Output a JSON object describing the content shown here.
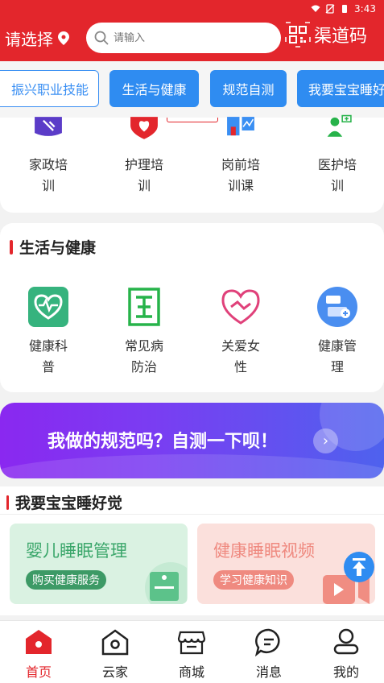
{
  "status": {
    "time": "3:43"
  },
  "header": {
    "location_label": "请选择",
    "search_placeholder": "请输入",
    "qr_label": "渠道码"
  },
  "tabs": [
    {
      "label": "振兴职业技能",
      "style": "outline"
    },
    {
      "label": "生活与健康",
      "style": "filled"
    },
    {
      "label": "规范自测",
      "style": "filled"
    },
    {
      "label": "我要宝宝睡好觉",
      "style": "filled"
    }
  ],
  "training": {
    "items": [
      {
        "line1": "家政培",
        "line2": "训",
        "icon": "housekeeping-icon"
      },
      {
        "line1": "护理培",
        "line2": "训",
        "icon": "nursing-heart-icon"
      },
      {
        "line1": "岗前培",
        "line2": "训课",
        "icon": "pre-job-training-icon"
      },
      {
        "line1": "医护培",
        "line2": "训",
        "icon": "medical-staff-icon"
      }
    ]
  },
  "health": {
    "title": "生活与健康",
    "items": [
      {
        "line1": "健康科",
        "line2": "普",
        "icon": "health-science-icon"
      },
      {
        "line1": "常见病",
        "line2": "防治",
        "icon": "disease-prevention-icon"
      },
      {
        "line1": "关爱女",
        "line2": "性",
        "icon": "care-women-icon"
      },
      {
        "line1": "健康管",
        "line2": "理",
        "icon": "health-management-icon"
      }
    ]
  },
  "banner": {
    "text": "我做的规范吗？自测一下呗！"
  },
  "sleep": {
    "title": "我要宝宝睡好觉",
    "cards": [
      {
        "title": "婴儿睡眠管理",
        "button": "购买健康服务"
      },
      {
        "title": "健康睡眠视频",
        "button": "学习健康知识"
      }
    ]
  },
  "nav": [
    {
      "label": "首页",
      "icon": "home-icon",
      "active": true
    },
    {
      "label": "云家",
      "icon": "cloud-home-icon",
      "active": false
    },
    {
      "label": "商城",
      "icon": "store-icon",
      "active": false
    },
    {
      "label": "消息",
      "icon": "message-icon",
      "active": false
    },
    {
      "label": "我的",
      "icon": "profile-icon",
      "active": false
    }
  ],
  "colors": {
    "brand_red": "#e3262c",
    "accent_blue": "#2f8cf1"
  }
}
